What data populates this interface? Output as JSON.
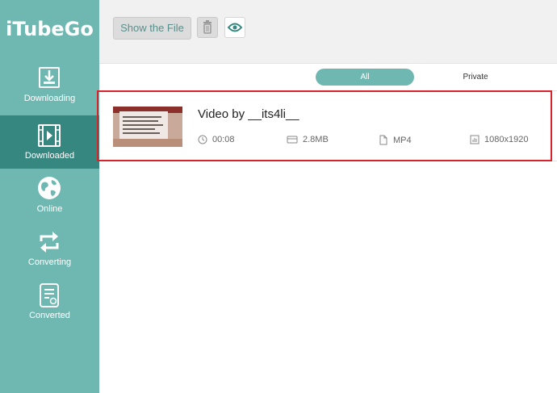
{
  "app": {
    "title": "iTubeGo"
  },
  "sidebar": {
    "items": [
      {
        "label": "Downloading",
        "icon": "download-icon"
      },
      {
        "label": "Downloaded",
        "icon": "film-icon",
        "active": true
      },
      {
        "label": "Online",
        "icon": "globe-icon"
      },
      {
        "label": "Converting",
        "icon": "convert-icon"
      },
      {
        "label": "Converted",
        "icon": "document-icon"
      }
    ]
  },
  "toolbar": {
    "show_file_label": "Show the File",
    "delete_icon": "trash-icon",
    "preview_icon": "eye-icon"
  },
  "filters": {
    "all": "All",
    "private": "Private"
  },
  "items": [
    {
      "title": "Video by __its4li__",
      "duration": "00:08",
      "size": "2.8MB",
      "format": "MP4",
      "resolution": "1080x1920"
    }
  ],
  "colors": {
    "sidebar": "#6fb8b2",
    "sidebar_active": "#35877f",
    "highlight": "#d9222a"
  }
}
